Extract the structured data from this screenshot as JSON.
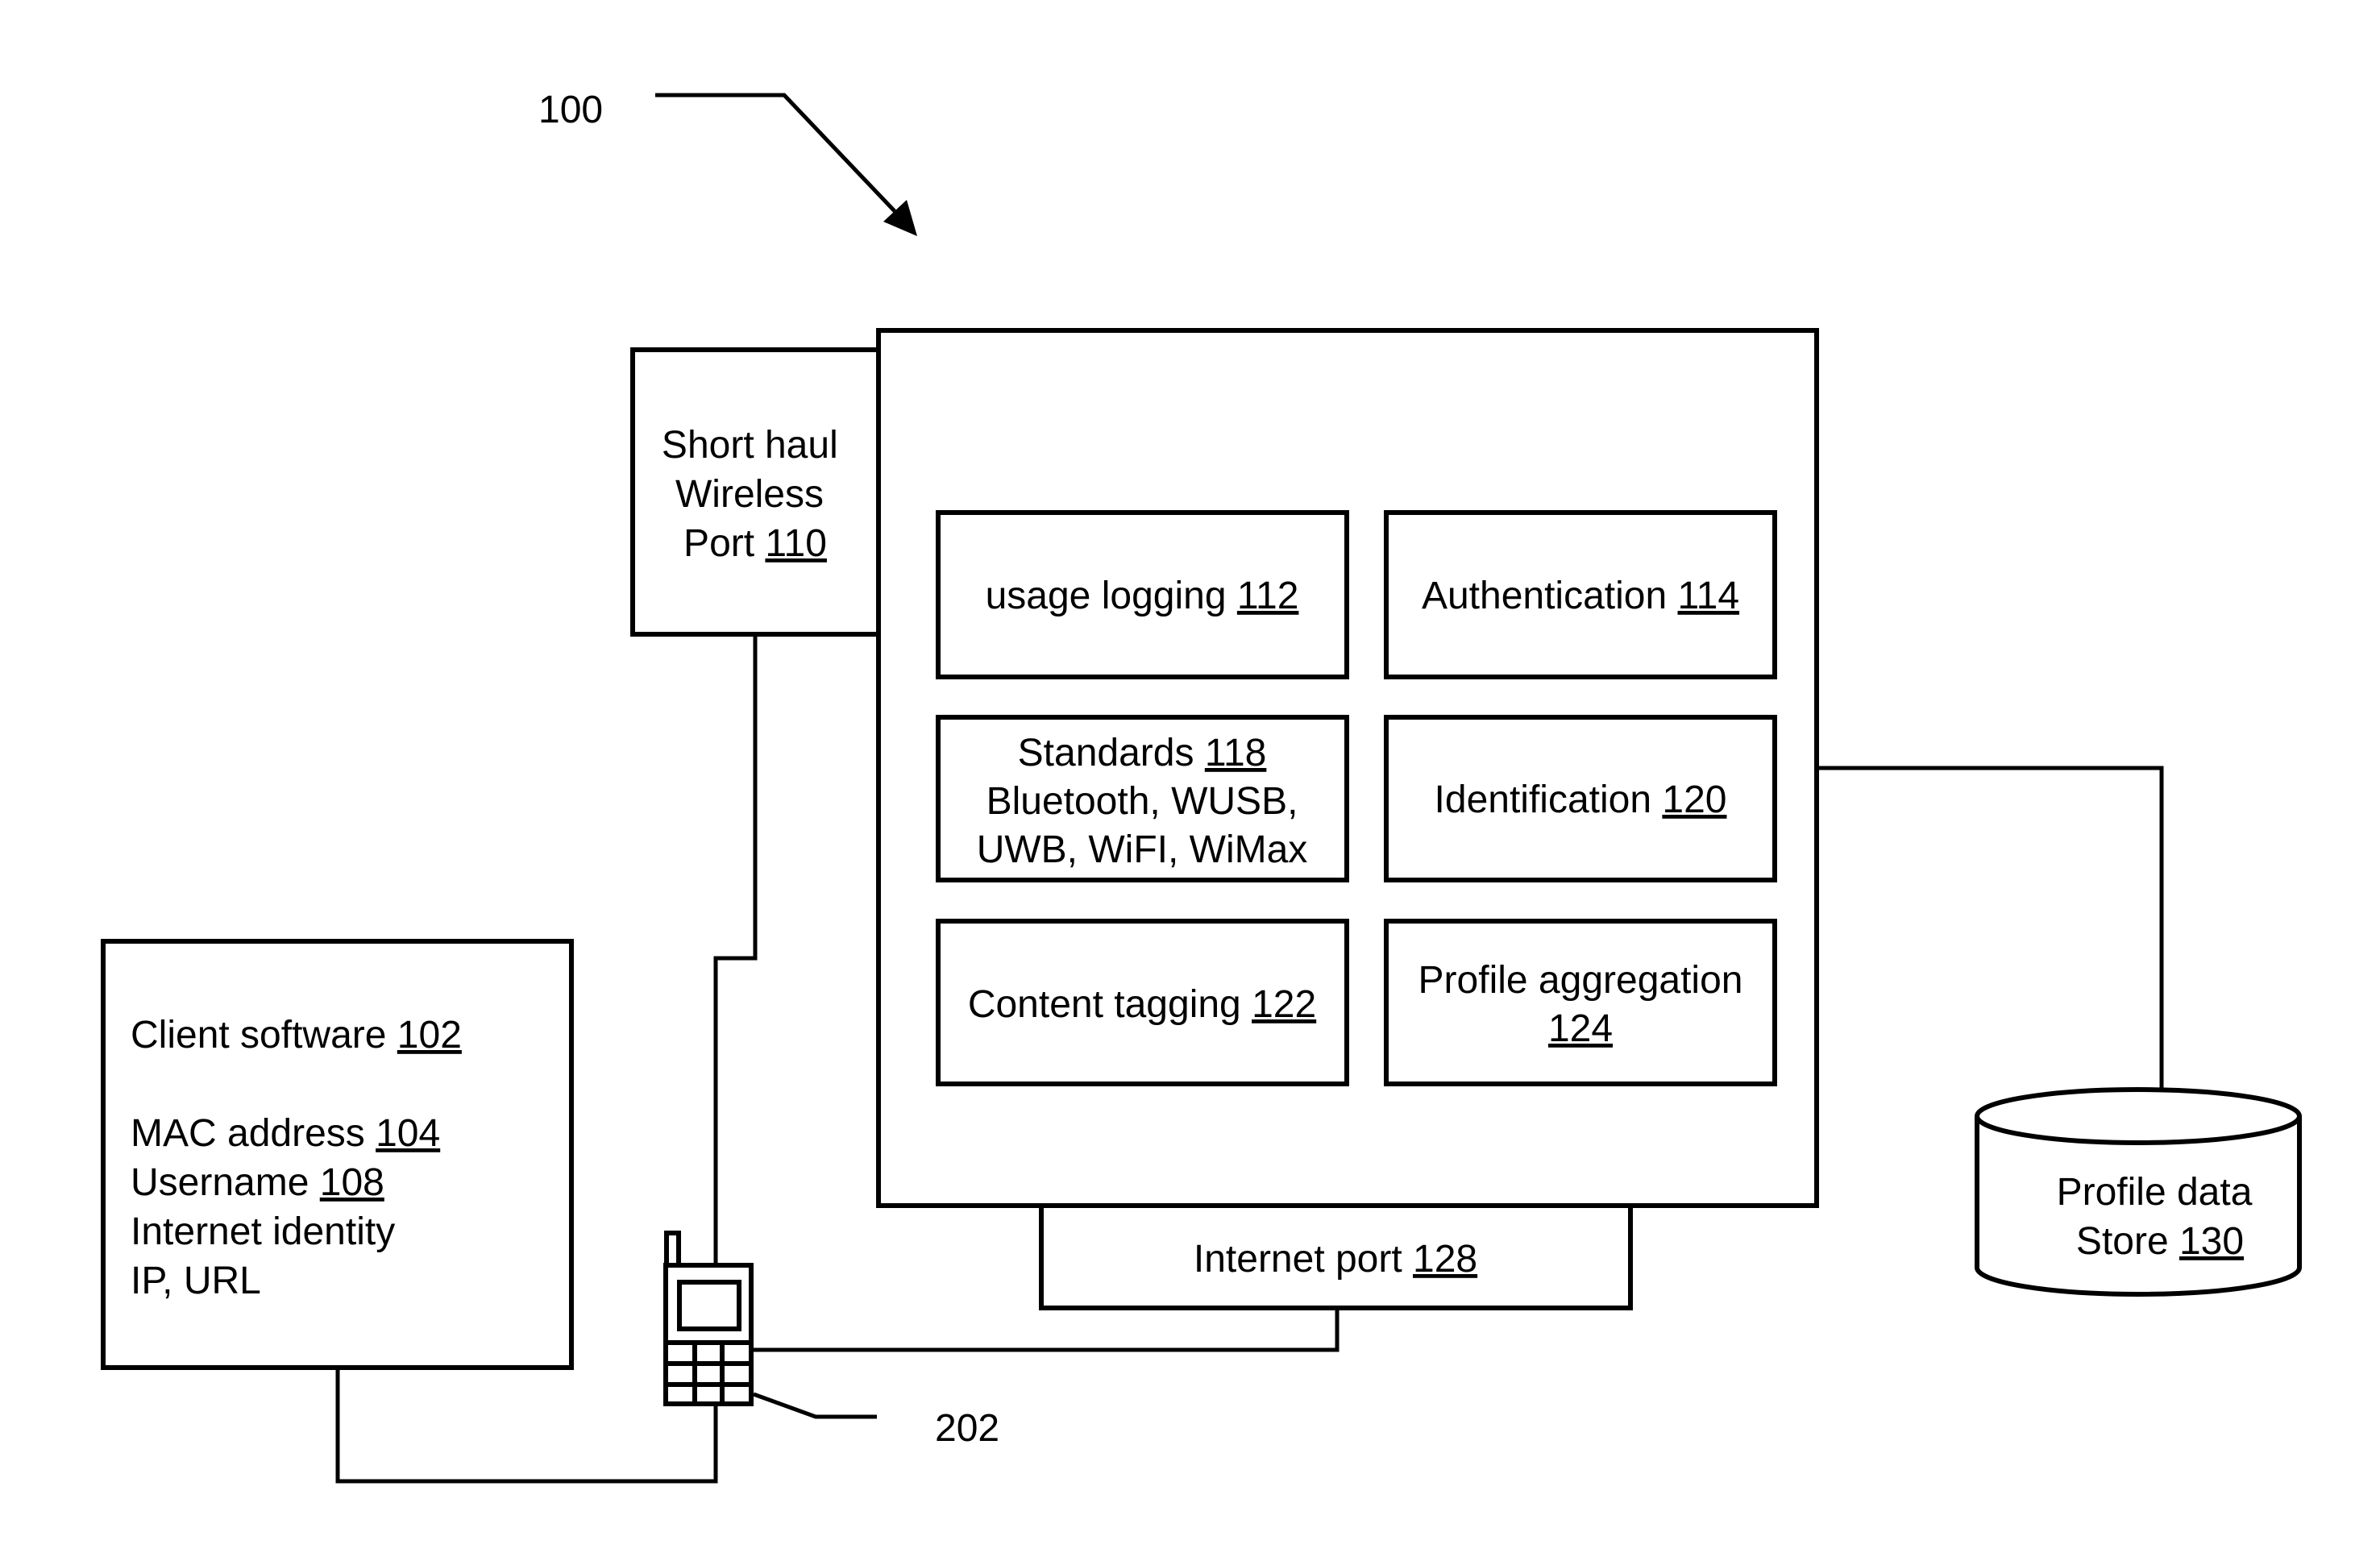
{
  "figure": {
    "reference_label": "100",
    "phone_label": "202"
  },
  "components": {
    "short_haul": {
      "lines": [
        "Short haul",
        "Wireless",
        "Port "
      ],
      "ref": "110"
    },
    "usage_logging": {
      "text": "usage logging ",
      "ref": "112"
    },
    "authentication": {
      "text": "Authentication ",
      "ref": "114"
    },
    "standards": {
      "text": "Standards ",
      "ref": "118",
      "line2": "Bluetooth, WUSB,",
      "line3": "UWB, WiFI, WiMax"
    },
    "identification": {
      "text": "Identification ",
      "ref": "120"
    },
    "content_tagging": {
      "text": "Content tagging ",
      "ref": "122"
    },
    "profile_aggregation": {
      "text": "Profile aggregation",
      "ref": "124"
    },
    "internet_port": {
      "text": "Internet port ",
      "ref": "128"
    },
    "profile_store": {
      "line1": "Profile data",
      "text": "Store ",
      "ref": "130"
    },
    "client": {
      "title": "Client software ",
      "title_ref": "102",
      "mac": "MAC address ",
      "mac_ref": "104",
      "username": "Username ",
      "username_ref": "108",
      "identity": "Internet identity",
      "ipurl": "IP, URL"
    }
  },
  "colors": {
    "stroke": "#000000",
    "background": "#ffffff"
  }
}
